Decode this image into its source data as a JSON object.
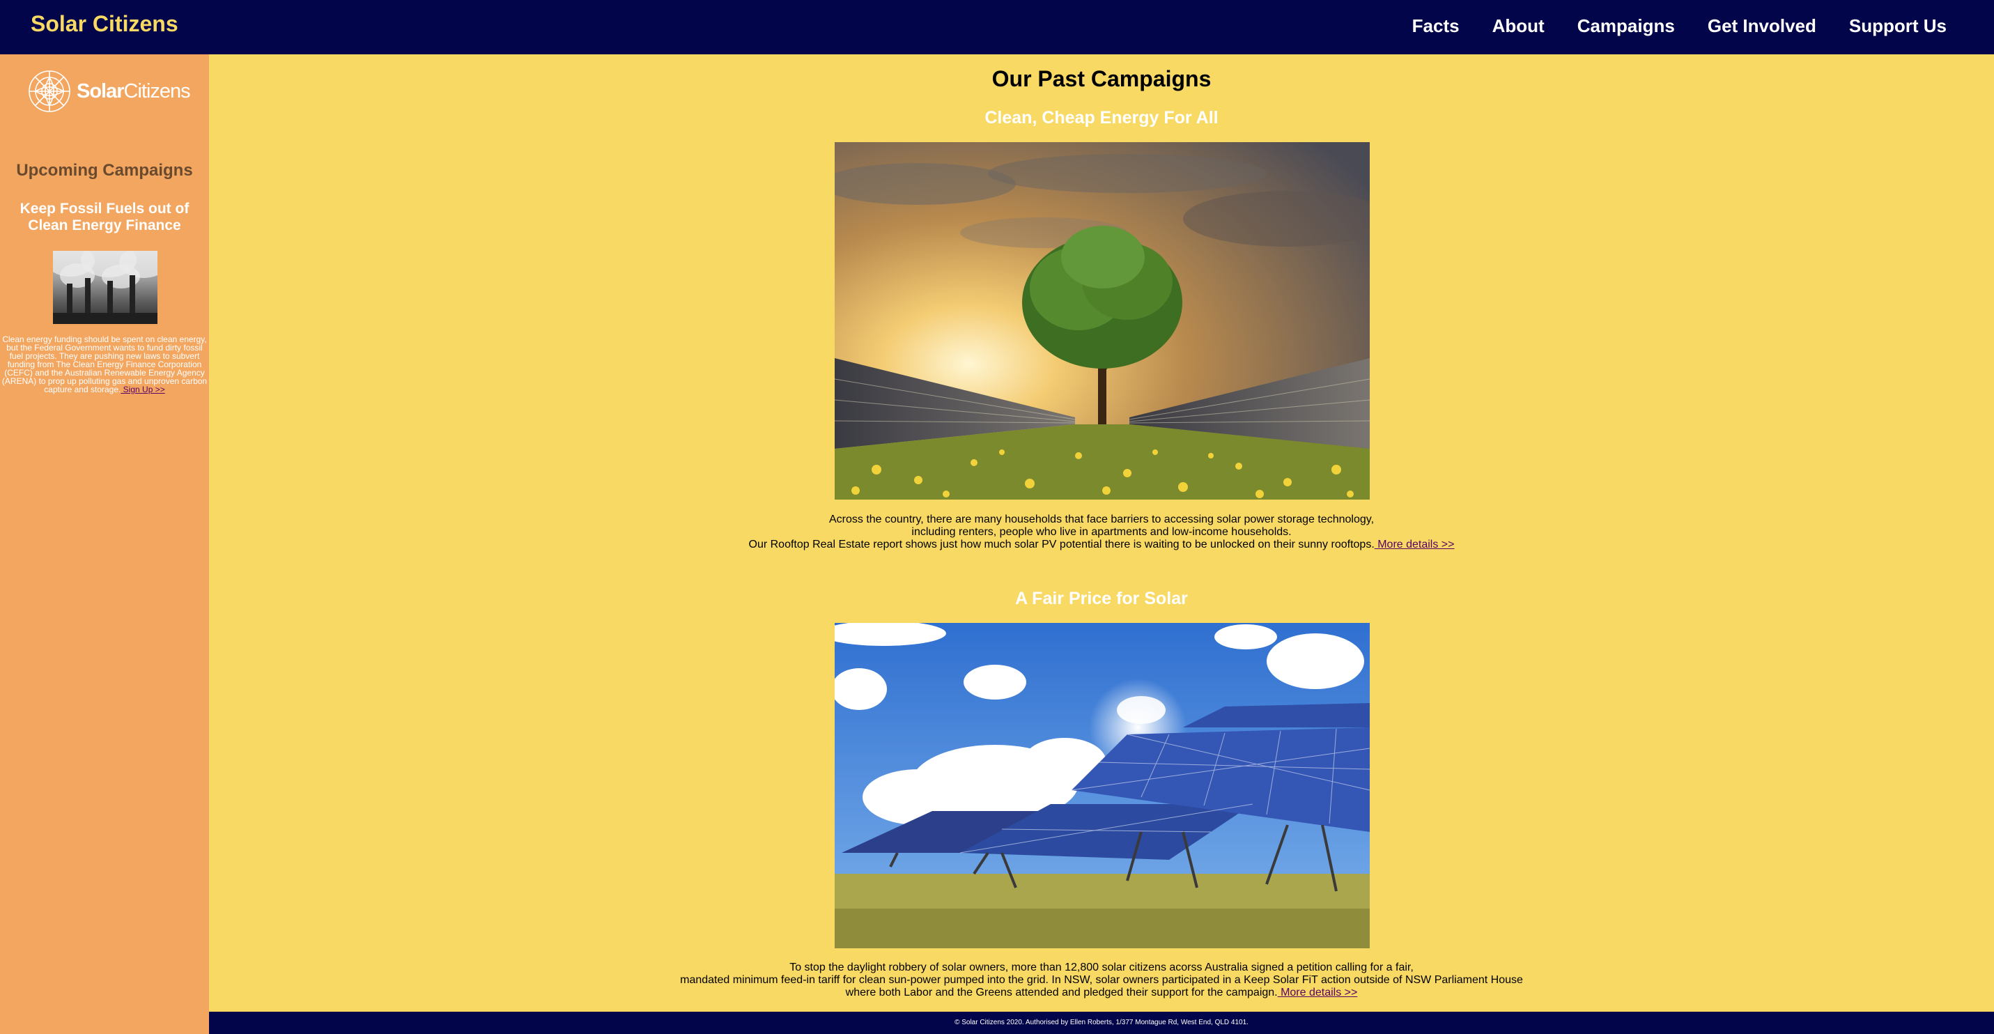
{
  "header": {
    "brand": "Solar Citizens",
    "nav": [
      "Facts",
      "About",
      "Campaigns",
      "Get Involved",
      "Support Us"
    ]
  },
  "sidebar": {
    "logo_text_bold": "Solar",
    "logo_text_light": "Citizens",
    "title": "Upcoming Campaigns",
    "campaign_title": "Keep Fossil Fuels out of Clean Energy Finance",
    "campaign_text": "Clean energy funding should be spent on clean energy, but the Federal Government wants to fund dirty fossil fuel projects. They are pushing new laws to subvert funding from The Clean Energy Finance Corporation (CEFC) and the Australian Renewable Energy Agency (ARENA) to prop up polluting gas and unproven carbon capture and storage.",
    "signup_link": " Sign Up >>"
  },
  "main": {
    "title": "Our Past Campaigns",
    "campaigns": [
      {
        "title": "Clean, Cheap Energy For All",
        "lines": [
          "Across the country, there are many households that face barriers to accessing solar power storage technology,",
          "including renters, people who live in apartments and low-income households.",
          "Our Rooftop Real Estate report shows just how much solar PV potential there is waiting to be unlocked on their sunny rooftops."
        ],
        "link": " More details >>"
      },
      {
        "title": "A Fair Price for Solar",
        "lines": [
          "To stop the daylight robbery of solar owners, more than 12,800 solar citizens acorss Australia signed a petition calling for a fair,",
          "mandated minimum feed-in tariff for clean sun-power pumped into the grid. In NSW, solar owners participated in a Keep Solar FiT action outside of NSW Parliament House",
          "where both Labor and the Greens attended and pledged their support for the campaign."
        ],
        "link": " More details >>"
      }
    ]
  },
  "footer": {
    "text": "© Solar Citizens 2020. Authorised by Ellen Roberts, 1/377 Montague Rd, West End, QLD 4101."
  }
}
